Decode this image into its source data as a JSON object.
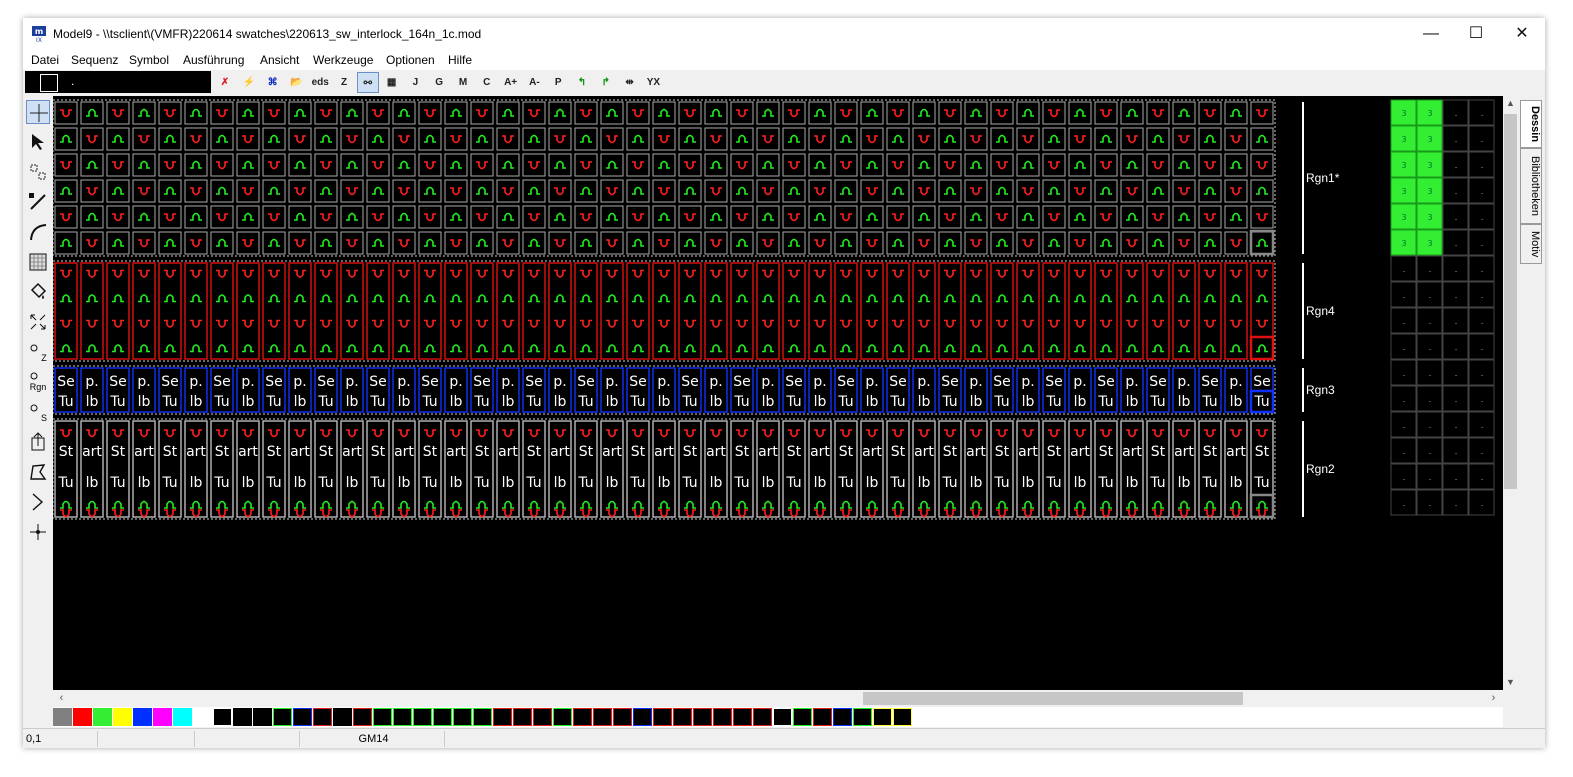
{
  "window": {
    "title": "Model9 - \\\\tsclient\\(VMFR)220614 swatches\\220613_sw_interlock_164n_1c.mod",
    "minimize_glyph": "—",
    "maximize_glyph": "☐",
    "close_glyph": "✕"
  },
  "menu": [
    "Datei",
    "Sequenz",
    "Symbol",
    "Ausführung",
    "Ansicht",
    "Werkzeuge",
    "Optionen",
    "Hilfe"
  ],
  "command_box": {
    "value": "."
  },
  "toolbar": [
    {
      "label": "✗",
      "icon": "red-x-icon",
      "color": "#e02020"
    },
    {
      "label": "⚡",
      "icon": "lightning-icon",
      "color": "#d0a000"
    },
    {
      "label": "⌘",
      "icon": "link-icon",
      "color": "#1030c0"
    },
    {
      "label": "📂",
      "icon": "open-folder-icon",
      "color": "#c08000"
    },
    {
      "label": "eds",
      "icon": "eds-download-icon",
      "color": "#222"
    },
    {
      "label": "Z",
      "icon": "z-icon",
      "color": "#222"
    },
    {
      "label": "⚯",
      "icon": "loop-link-icon",
      "color": "#222"
    },
    {
      "label": "▦",
      "icon": "checker-icon",
      "color": "#222"
    },
    {
      "label": "J",
      "icon": "j-icon",
      "color": "#222"
    },
    {
      "label": "G",
      "icon": "g-icon",
      "color": "#222"
    },
    {
      "label": "M",
      "icon": "m-icon",
      "color": "#222"
    },
    {
      "label": "C",
      "icon": "c-icon",
      "color": "#222"
    },
    {
      "label": "A+",
      "icon": "a-plus-icon",
      "color": "#222"
    },
    {
      "label": "A-",
      "icon": "a-minus-icon",
      "color": "#222"
    },
    {
      "label": "P",
      "icon": "p-icon",
      "color": "#222"
    },
    {
      "label": "↰",
      "icon": "turn-left-icon",
      "color": "#109010"
    },
    {
      "label": "↱",
      "icon": "turn-right-icon",
      "color": "#109010"
    },
    {
      "label": "⇹",
      "icon": "mirror-icon",
      "color": "#222"
    },
    {
      "label": "YX",
      "icon": "yx-icon",
      "color": "#222"
    }
  ],
  "left_tools": [
    {
      "name": "crosshair-tool",
      "label": ""
    },
    {
      "name": "arrow-select-tool",
      "label": ""
    },
    {
      "name": "box-select-tool",
      "label": ""
    },
    {
      "name": "line-draw-tool",
      "label": ""
    },
    {
      "name": "curve-tool",
      "label": ""
    },
    {
      "name": "grid-fill-tool",
      "label": ""
    },
    {
      "name": "paint-bucket-tool",
      "label": ""
    },
    {
      "name": "expand-tool",
      "label": ""
    },
    {
      "name": "z-loop-tool",
      "label": "Z"
    },
    {
      "name": "region-tool",
      "label": "Rgn"
    },
    {
      "name": "s-loop-tool",
      "label": "S"
    },
    {
      "name": "insert-tool",
      "label": ""
    },
    {
      "name": "polygon-tool",
      "label": ""
    },
    {
      "name": "zigzag-tool",
      "label": ""
    },
    {
      "name": "point-tool",
      "label": ""
    }
  ],
  "regions": [
    {
      "label": "Rgn1*",
      "kind": "loops",
      "rows": 6,
      "color": "#aaaaaa",
      "highlight": "#888888"
    },
    {
      "label": "Rgn4",
      "kind": "red",
      "rows": 4,
      "color": "#e01010",
      "highlight": "#e01010"
    },
    {
      "label": "Rgn3",
      "kind": "blue",
      "rows": 2,
      "color": "#1030ff",
      "highlight": "#1030ff"
    },
    {
      "label": "Rgn2",
      "kind": "white",
      "rows": 4,
      "color": "#bbbbbb",
      "highlight": "#888888"
    }
  ],
  "cell_text": {
    "rgn3_row1": [
      "Se",
      "p."
    ],
    "rgn3_row2": [
      "Tu",
      "lb"
    ],
    "rgn2_row2": [
      "St",
      "art"
    ],
    "rgn2_row3": [
      "Tu",
      "lb"
    ]
  },
  "columns": 47,
  "motif_grid": {
    "cols": 4,
    "rows": 16,
    "on_value": "3",
    "off_value": ".",
    "on_rows": 6,
    "on_cols": 2
  },
  "side_tabs": [
    "Dessin",
    "Bibliotheken",
    "Motiv"
  ],
  "palette": [
    "#808080",
    "#ff0000",
    "#33ee33",
    "#ffff00",
    "#0030ff",
    "#ff00ff",
    "#00ffff",
    "#ffffff"
  ],
  "statusbar": {
    "coords": "0,1",
    "field2": "",
    "field3": "",
    "gauge": "GM14"
  },
  "colors": {
    "loop_red": "#ff2020",
    "loop_green": "#22ee22",
    "canvas_bg": "#000000"
  }
}
